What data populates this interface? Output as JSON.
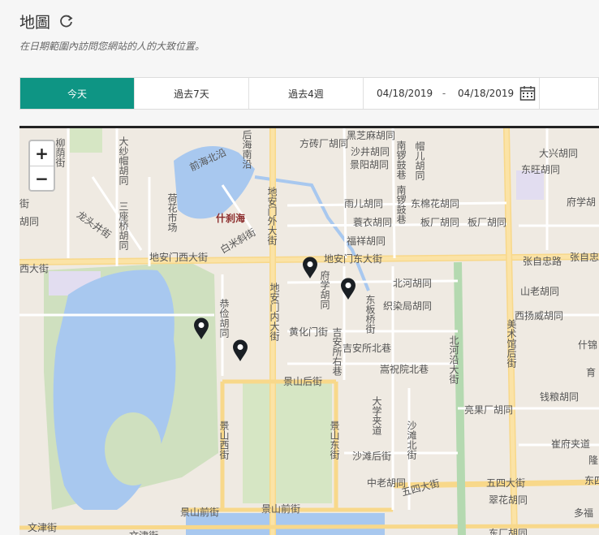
{
  "header": {
    "title": "地圖",
    "subtitle": "在日期範圍內訪問您網站的人的大致位置。"
  },
  "toolbar": {
    "ranges": [
      {
        "label": "今天",
        "active": true
      },
      {
        "label": "過去7天",
        "active": false
      },
      {
        "label": "過去4週",
        "active": false
      }
    ],
    "start_date": "04/18/2019",
    "separator": "-",
    "end_date": "04/18/2019"
  },
  "map": {
    "zoom_in": "+",
    "zoom_out": "−",
    "labels": {
      "l1": "黑芝麻胡同",
      "l2": "沙井胡同",
      "l3": "景阳胡同",
      "l4": "雨儿胡同",
      "l5": "东棉花胡同",
      "l6": "蓑衣胡同",
      "l7": "板厂胡同",
      "l8": "板厂胡同",
      "l9": "福祥胡同",
      "l10": "地安门东大街",
      "l11": "北河胡同",
      "l12": "织染局胡同",
      "l13": "张自忠路",
      "l14": "张自忠",
      "l15": "山老胡同",
      "l16": "西扬威胡同",
      "l17": "大兴胡同",
      "l18": "东旺胡同",
      "l19": "府学胡",
      "l20": "地安门西大街",
      "l21": "西大街",
      "l22": "什刹海",
      "l23": "前海北沿",
      "l24": "黄化门街",
      "l25": "吉安所北巷",
      "l26": "嵩祝院北巷",
      "l27": "景山后街",
      "l28": "景山前街",
      "l29": "景山前街",
      "l30": "亮果厂胡同",
      "l31": "钱粮胡同",
      "l32": "崔府夹道",
      "l33": "中老胡同",
      "l34": "五四大街",
      "l35": "五四大街",
      "l36": "翠花胡同",
      "l37": "东厂胡同",
      "l38": "文津街",
      "l39": "文津街",
      "l40": "沙滩后街",
      "l41": "育",
      "l42": "什锦",
      "l43": "隆",
      "l44": "多福",
      "l45": "东四",
      "l46": "大纱帽胡同",
      "l47": "三座桥胡同",
      "l48": "龙头井街",
      "l49": "柳荫街",
      "l50": "胡同",
      "l51": "街",
      "l52": "南锣鼓巷",
      "l53": "南锣鼓巷",
      "l54": "地安门外大街",
      "l55": "地安门内大街",
      "l56": "府学胡同",
      "l57": "东板桥街",
      "l58": "吉安所右巷",
      "l59": "恭俭胡同",
      "l60": "景山西街",
      "l61": "景山东街",
      "l62": "大学夹道",
      "l63": "沙滩北街",
      "l64": "北河沿大街",
      "l65": "美术馆后街",
      "l66": "荷花市场",
      "l67": "白米斜街",
      "l68": "方砖厂胡同",
      "l69": "帽儿胡同",
      "l70": "后海南沿"
    }
  }
}
